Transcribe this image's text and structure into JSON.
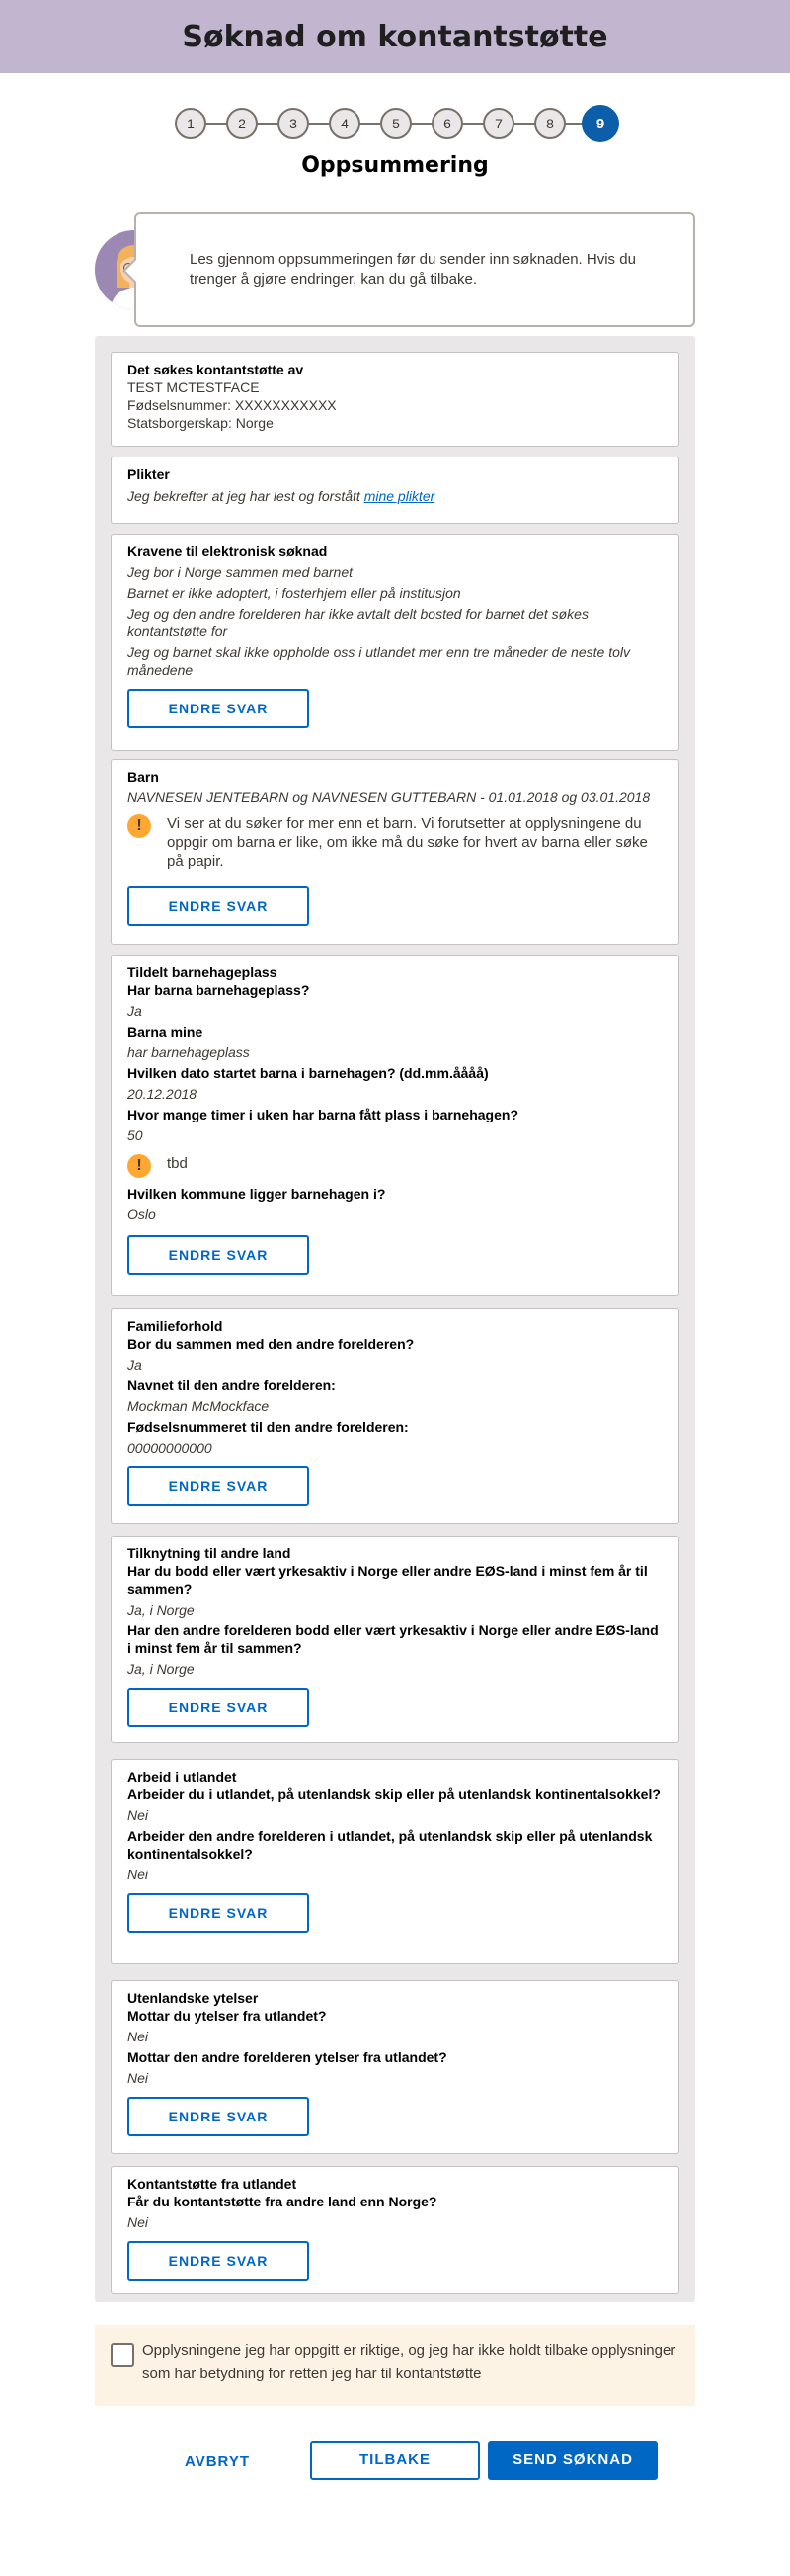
{
  "header": {
    "title": "Søknad om kontantstøtte"
  },
  "stepper": {
    "steps": [
      "1",
      "2",
      "3",
      "4",
      "5",
      "6",
      "7",
      "8",
      "9"
    ],
    "active": 9,
    "title": "Oppsummering"
  },
  "veileder": {
    "text": "Les gjennom oppsummeringen før du sender inn søknaden. Hvis du trenger å gjøre endringer, kan du gå tilbake."
  },
  "edit_label": "ENDRE SVAR",
  "sections": {
    "applicant": {
      "title": "Det søkes kontantstøtte av",
      "name": "TEST MCTESTFACE",
      "fnr": "Fødselsnummer: XXXXXXXXXXX",
      "citizenship": "Statsborgerskap: Norge"
    },
    "duties": {
      "title": "Plikter",
      "text": "Jeg bekrefter at jeg har lest og forstått",
      "link": "mine plikter"
    },
    "requirements": {
      "title": "Kravene til elektronisk søknad",
      "items": [
        "Jeg bor i Norge sammen med barnet",
        "Barnet er ikke adoptert, i fosterhjem eller på institusjon",
        "Jeg og den andre forelderen har ikke avtalt delt bosted for barnet det søkes kontantstøtte for",
        "Jeg og barnet skal ikke oppholde oss i utlandet mer enn tre måneder de neste tolv månedene"
      ]
    },
    "children": {
      "title": "Barn",
      "names": "NAVNESEN JENTEBARN og NAVNESEN GUTTEBARN - 01.01.2018 og 03.01.2018",
      "alert": "Vi ser at du søker for mer enn et barn. Vi forutsetter at opplysningene du oppgir om barna er like, om ikke må du søke for hvert av barna eller søke på papir."
    },
    "kindergarten": {
      "title": "Tildelt barnehageplass",
      "q1": "Har barna barnehageplass?",
      "a1": "Ja",
      "q2": "Barna mine",
      "a2": "har barnehageplass",
      "q3": "Hvilken dato startet barna i barnehagen? (dd.mm.åååå)",
      "a3": "20.12.2018",
      "q4": "Hvor mange timer i uken har barna fått plass i barnehagen?",
      "a4": "50",
      "alert": "tbd",
      "q5": "Hvilken kommune ligger barnehagen i?",
      "a5": "Oslo"
    },
    "family": {
      "title": "Familieforhold",
      "q1": "Bor du sammen med den andre forelderen?",
      "a1": "Ja",
      "q2": "Navnet til den andre forelderen:",
      "a2": "Mockman McMockface",
      "q3": "Fødselsnummeret til den andre forelderen:",
      "a3": "00000000000"
    },
    "connection": {
      "title": "Tilknytning til andre land",
      "q1": "Har du bodd eller vært yrkesaktiv i Norge eller andre EØS-land i minst fem år til sammen?",
      "a1": "Ja, i Norge",
      "q2": "Har den andre forelderen bodd eller vært yrkesaktiv i Norge eller andre EØS-land i minst fem år til sammen?",
      "a2": "Ja, i Norge"
    },
    "work_abroad": {
      "title": "Arbeid i utlandet",
      "q1": "Arbeider du i utlandet, på utenlandsk skip eller på utenlandsk kontinentalsokkel?",
      "a1": "Nei",
      "q2": "Arbeider den andre forelderen i utlandet, på utenlandsk skip eller på utenlandsk kontinentalsokkel?",
      "a2": "Nei"
    },
    "foreign_benefits": {
      "title": "Utenlandske ytelser",
      "q1": "Mottar du ytelser fra utlandet?",
      "a1": "Nei",
      "q2": "Mottar den andre forelderen ytelser fra utlandet?",
      "a2": "Nei"
    },
    "foreign_support": {
      "title": "Kontantstøtte fra utlandet",
      "q1": "Får du kontantstøtte fra andre land enn Norge?",
      "a1": "Nei"
    }
  },
  "confirm": {
    "text": "Opplysningene jeg har oppgitt er riktige, og jeg har ikke holdt tilbake opplysninger som har betydning for retten jeg har til kontantstøtte",
    "checked": false
  },
  "buttons": {
    "cancel": "AVBRYT",
    "back": "TILBAKE",
    "send": "SEND SØKNAD"
  }
}
